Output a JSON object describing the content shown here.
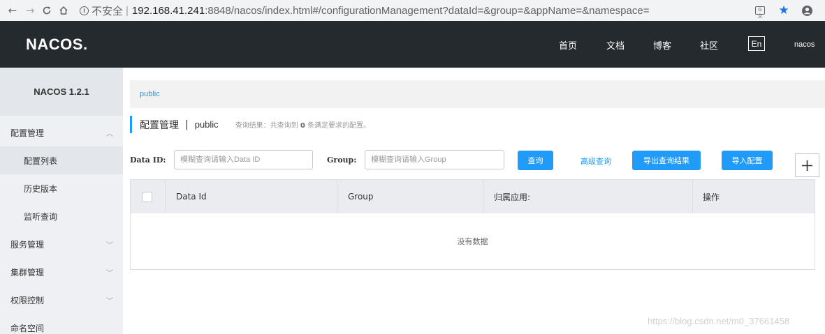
{
  "browser": {
    "security_label": "不安全",
    "separator": "|",
    "url_host": "192.168.41.241",
    "url_rest": ":8848/nacos/index.html#/configurationManagement?dataId=&group=&appName=&namespace=",
    "translate_glyph": "G文"
  },
  "header": {
    "logo": "NACOS.",
    "nav": [
      "首页",
      "文档",
      "博客",
      "社区"
    ],
    "lang_button": "En",
    "user": "nacos"
  },
  "sidebar": {
    "version": "NACOS 1.2.1",
    "menus": [
      {
        "label": "配置管理",
        "expanded": true,
        "children": [
          "配置列表",
          "历史版本",
          "监听查询"
        ]
      },
      {
        "label": "服务管理",
        "expanded": false
      },
      {
        "label": "集群管理",
        "expanded": false
      },
      {
        "label": "权限控制",
        "expanded": false
      },
      {
        "label": "命名空间"
      }
    ],
    "active_child": "配置列表"
  },
  "main": {
    "namespace_tab": "public",
    "title": "配置管理",
    "title_separator": "|",
    "title_namespace": "public",
    "query_result_prefix": "查询结果：共查询到",
    "query_result_count": "0",
    "query_result_suffix": "条满足要求的配置。",
    "filters": {
      "dataid_label": "Data ID:",
      "dataid_placeholder": "模糊查询请输入Data ID",
      "dataid_value": "",
      "group_label": "Group:",
      "group_placeholder": "模糊查询请输入Group",
      "group_value": ""
    },
    "buttons": {
      "query": "查询",
      "advanced_query": "高级查询",
      "export": "导出查询结果",
      "import": "导入配置"
    },
    "table": {
      "columns": [
        "Data Id",
        "Group",
        "归属应用:",
        "操作"
      ],
      "empty_text": "没有数据"
    }
  },
  "watermark": "https://blog.csdn.net/m0_37661458",
  "colors": {
    "accent": "#209bfa",
    "header_bg": "#252a2f",
    "sidebar_bg": "#eef0f3"
  }
}
